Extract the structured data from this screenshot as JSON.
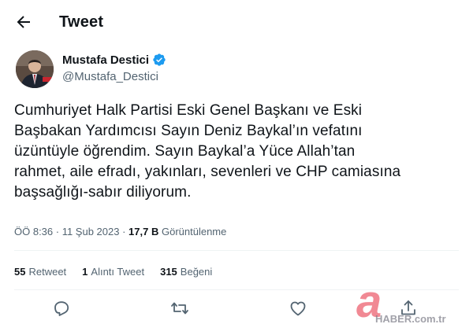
{
  "header": {
    "title": "Tweet",
    "back_icon": "arrow-left-icon"
  },
  "author": {
    "name": "Mustafa Destici",
    "handle": "@Mustafa_Destici",
    "verified_icon": "verified-badge-icon",
    "verified_color": "#1d9bf0"
  },
  "tweet": {
    "lines": [
      "Cumhuriyet Halk Partisi Eski Genel Başkanı ve Eski",
      "Başbakan Yardımcısı Sayın Deniz Baykal’ın vefatını",
      "üzüntüyle öğrendim. Sayın Baykal’a Yüce Allah’tan",
      "rahmet, aile efradı, yakınları, sevenleri ve CHP camiasına",
      "başsağlığı-sabır diliyorum."
    ]
  },
  "meta": {
    "time": "ÖÖ 8:36",
    "separator": " · ",
    "date": "11 Şub 2023",
    "views_count": "17,7 B",
    "views_label": "Görüntülenme"
  },
  "stats": {
    "retweets_count": "55",
    "retweets_label": "Retweet",
    "quotes_count": "1",
    "quotes_label": "Alıntı Tweet",
    "likes_count": "315",
    "likes_label": "Beğeni"
  },
  "actions": [
    "reply-icon",
    "retweet-icon",
    "like-icon",
    "share-icon"
  ],
  "watermark": {
    "letter": "a",
    "text": "HABER.com.tr"
  },
  "colors": {
    "text": "#0f1419",
    "secondary": "#536471",
    "divider": "#eff3f4",
    "accent": "#1d9bf0"
  }
}
